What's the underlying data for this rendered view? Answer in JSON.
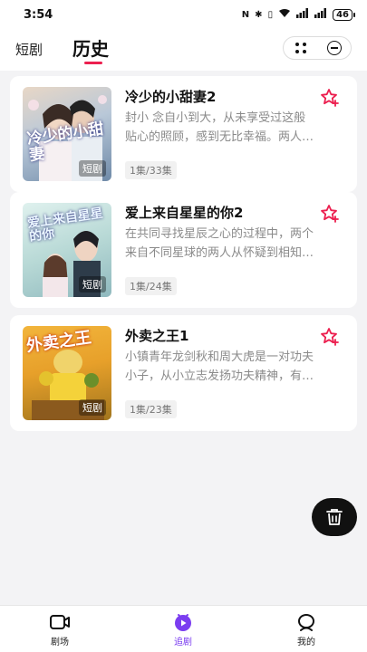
{
  "status_bar": {
    "time": "3:54",
    "battery": "46",
    "signal1": "⁴ᴳ",
    "signal2": "⁴ᴳ"
  },
  "header": {
    "tab_short": "短剧",
    "tab_history": "历史"
  },
  "accent_color": "#ec1f4f",
  "nav_active_color": "#7b3df0",
  "items": [
    {
      "title": "冷少的小甜妻2",
      "poster_title": "冷少的小甜妻",
      "poster_tag": "短剧",
      "desc_line1": "封小 念自小到大，从未享受过这般",
      "desc_line2": "贴心的照顾，感到无比幸福。两人…",
      "episodes": "1集/33集",
      "favorite_icon": "star-add-icon"
    },
    {
      "title": "爱上来自星星的你2",
      "poster_title": "爱上来自星星的你",
      "poster_tag": "短剧",
      "desc_line1": "在共同寻找星辰之心的过程中，两个",
      "desc_line2": "来自不同星球的两人从怀疑到相知…",
      "episodes": "1集/24集",
      "favorite_icon": "star-add-icon"
    },
    {
      "title": "外卖之王1",
      "poster_title": "外卖之王",
      "poster_tag": "短剧",
      "desc_line1": "小镇青年龙剑秋和周大虎是一对功夫",
      "desc_line2": "小子，从小立志发扬功夫精神，有…",
      "episodes": "1集/23集",
      "favorite_icon": "star-add-icon"
    }
  ],
  "bottom_nav": [
    {
      "label": "剧场",
      "icon": "video-icon"
    },
    {
      "label": "追剧",
      "icon": "play-circle-icon"
    },
    {
      "label": "我的",
      "icon": "profile-icon"
    }
  ]
}
